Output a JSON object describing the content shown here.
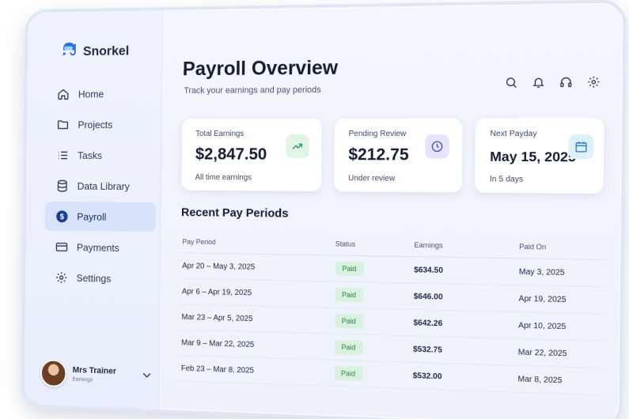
{
  "brand": {
    "name": "Snorkel"
  },
  "sidebar": {
    "items": [
      {
        "label": "Home",
        "icon": "home-icon",
        "active": false
      },
      {
        "label": "Projects",
        "icon": "folder-icon",
        "active": false
      },
      {
        "label": "Tasks",
        "icon": "list-icon",
        "active": false
      },
      {
        "label": "Data Library",
        "icon": "database-icon",
        "active": false
      },
      {
        "label": "Payroll",
        "icon": "dollar-icon",
        "active": true
      },
      {
        "label": "Payments",
        "icon": "credit-card-icon",
        "active": false
      },
      {
        "label": "Settings",
        "icon": "gear-icon",
        "active": false
      }
    ]
  },
  "user": {
    "name": "Mrs Trainer",
    "role": "Earnings"
  },
  "header": {
    "title": "Payroll Overview",
    "subtitle": "Track your earnings and pay periods",
    "icons": [
      "search-icon",
      "bell-icon",
      "headset-icon",
      "gear-icon"
    ]
  },
  "cards": [
    {
      "label": "Total Earnings",
      "value": "$2,847.50",
      "note": "All time earnings",
      "icon": "trending-up-icon",
      "accent": "#2e9a58",
      "accent_bg": "#e1f5e7"
    },
    {
      "label": "Pending Review",
      "value": "$212.75",
      "note": "Under review",
      "icon": "clock-icon",
      "accent": "#4a4fb0",
      "accent_bg": "#e4e5fa"
    },
    {
      "label": "Next Payday",
      "value": "May 15, 2025",
      "note": "In 5 days",
      "icon": "calendar-icon",
      "accent": "#2f7cc0",
      "accent_bg": "#def0fb"
    }
  ],
  "recent": {
    "title": "Recent Pay Periods",
    "headers": [
      "Pay Period",
      "Status",
      "Earnings",
      "Paid On"
    ],
    "rows": [
      {
        "period": "Apr 20 – May 3, 2025",
        "status": "Paid",
        "earnings": "$634.50",
        "paid_on": "May 3, 2025"
      },
      {
        "period": "Apr 6 – Apr 19, 2025",
        "status": "Paid",
        "earnings": "$646.00",
        "paid_on": "Apr 19, 2025"
      },
      {
        "period": "Mar 23 – Apr 5, 2025",
        "status": "Paid",
        "earnings": "$642.26",
        "paid_on": "Apr 10, 2025"
      },
      {
        "period": "Mar 9 – Mar 22, 2025",
        "status": "Paid",
        "earnings": "$532.75",
        "paid_on": "Mar 22, 2025"
      },
      {
        "period": "Feb 23 – Mar 8, 2025",
        "status": "Paid",
        "earnings": "$532.00",
        "paid_on": "Mar 8, 2025"
      }
    ]
  },
  "colors": {
    "status_paid_bg": "#d9f2df",
    "status_paid_text": "#2e7d46",
    "active_nav_bg": "#d8e3fb"
  }
}
